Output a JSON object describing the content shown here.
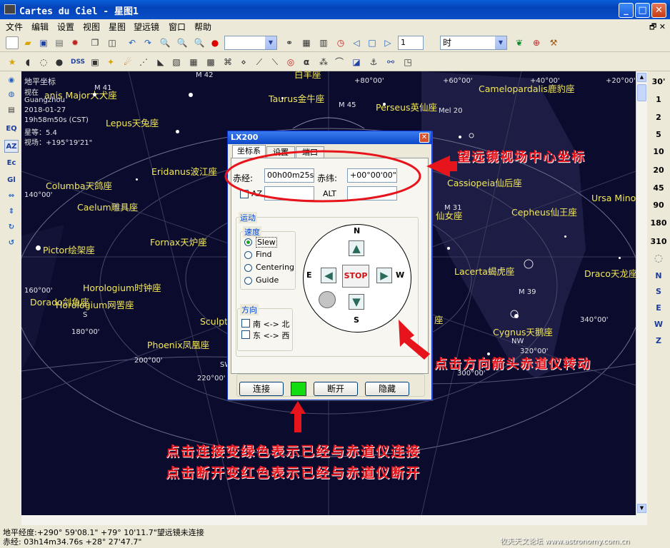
{
  "window": {
    "title": "Cartes du Ciel - 星图1"
  },
  "menu": [
    "文件",
    "编辑",
    "设置",
    "视图",
    "星图",
    "望远镜",
    "窗口",
    "帮助"
  ],
  "toolbar1": {
    "fov_value": "1",
    "time_unit": "时"
  },
  "toolbar2": {
    "dss_label": "DSS",
    "alpha_label": "α"
  },
  "left_toolbar": [
    "EQ",
    "AZ",
    "Ec",
    "Gl"
  ],
  "fov_scale": [
    "30'",
    "1",
    "2",
    "5",
    "10",
    "20",
    "45",
    "90",
    "180",
    "310"
  ],
  "direction_buttons": [
    "N",
    "S",
    "E",
    "W",
    "Z"
  ],
  "info": {
    "coord_system": "地平坐标",
    "view": "视在",
    "location": "Guangzhou",
    "date": "2018-01-27",
    "time": "19h58m50s (CST)",
    "magnitude": "星等：5.4",
    "fov": "视场：+195°19'21\""
  },
  "sky_labels": {
    "canis_major": "anis Major大犬座",
    "taurus": "Taurus金牛座",
    "perseus": "Perseus英仙座",
    "camelopardalis": "Camelopardalis鹿豹座",
    "lepus": "Lepus天兔座",
    "eridanus": "Eridanus波江座",
    "columba": "Columba天鸽座",
    "caelum": "Caelum雕具座",
    "cassiopeia": "Cassiopeia仙后座",
    "ursa_minor": "Ursa Minor",
    "andromeda_frag": "仙女座",
    "cepheus": "Cepheus仙王座",
    "pictor": "Pictor绘架座",
    "fornax": "Fornax天炉座",
    "lacerta": "Lacerta蝎虎座",
    "draco": "Draco天龙座",
    "horologium": "Horologium时钟座",
    "dorado": "Dorado剑鱼座",
    "horologium2": "Horologium网罟座",
    "sculpt": "Sculpt",
    "pegasus_frag": "座",
    "cygnus": "Cygnus天鹅座",
    "phoenix": "Phoenix凤凰座",
    "aries_frag": "白羊座"
  },
  "sky_small": {
    "ra80": "+80°00'",
    "ra60": "+60°00'",
    "ra40": "+40°00'",
    "ra20": "+20°00'",
    "az140": "140°00'",
    "az160": "160°00'",
    "az180": "180°00'",
    "az200": "200°00'",
    "az220": "220°00'",
    "az300": "300°00'",
    "az320": "320°00'",
    "az340": "340°00'",
    "m42": "M 42",
    "m41": "M 41",
    "m45": "M 45",
    "mel20": "Mel 20",
    "m31": "M 31",
    "m39": "M 39",
    "nw": "NW",
    "s": "S",
    "sw": "SW"
  },
  "dialog": {
    "title": "LX200",
    "tabs": [
      "坐标系",
      "设置",
      "端口"
    ],
    "ra_label": "赤经:",
    "ra_value": "00h00m25s",
    "dec_label": "赤纬:",
    "dec_value": "+00°00'00\"",
    "az_label": "AZ",
    "alt_label": "ALT",
    "motion_group": "运动",
    "speed_group": "速度",
    "speeds": [
      "Slew",
      "Find",
      "Centering",
      "Guide"
    ],
    "direction_group": "方向",
    "dir_ns": "南 <-> 北",
    "dir_ew": "东 <-> 西",
    "compass": {
      "n": "N",
      "s": "S",
      "e": "E",
      "w": "W"
    },
    "stop_label": "STOP",
    "connect_label": "连接",
    "disconnect_label": "断开",
    "hide_label": "隐藏",
    "status_color": "#11dd11"
  },
  "annotations": {
    "telescope_center": "望远镜视场中心坐标",
    "arrow_click": "点击方向箭头赤道仪转动",
    "connect_note1": "点击连接变绿色表示已经与赤道仪连接",
    "connect_note2": "点击断开变红色表示已经与赤道仪断开"
  },
  "status": {
    "line1": "地平经度:+290° 59'08.1\" +79° 10'11.7\"望远镜未连接",
    "line2": "赤经: 03h14m34.76s +28° 27'47.7\"",
    "watermark": "牧夫天文论坛 www.astronomy.com.cn"
  }
}
